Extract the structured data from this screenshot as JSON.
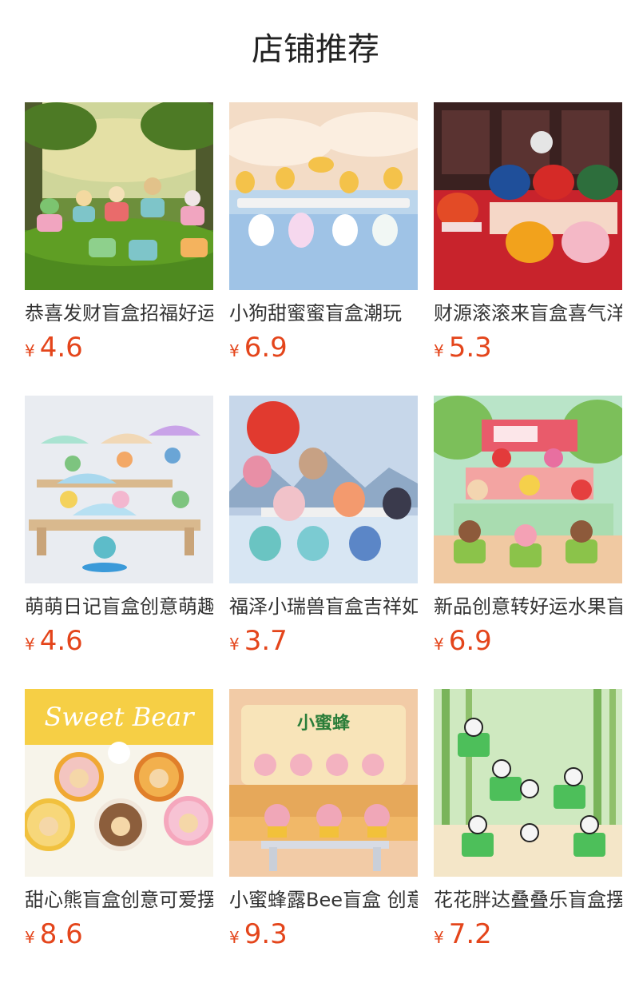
{
  "page": {
    "title": "店铺推荐"
  },
  "products": [
    {
      "name": "恭喜发财盲盒招福好运",
      "currency": "¥",
      "price": "4.6",
      "image": "garden-figurine-set"
    },
    {
      "name": "小狗甜蜜蜜盲盒潮玩",
      "currency": "¥",
      "price": "6.9",
      "image": "puppy-figurine-set"
    },
    {
      "name": "财源滚滚来盲盒喜气洋洋",
      "currency": "¥",
      "price": "5.3",
      "image": "fortune-god-figurine-set"
    },
    {
      "name": "萌萌日记盲盒创意萌趣",
      "currency": "¥",
      "price": "4.6",
      "image": "umbrella-figurine-set"
    },
    {
      "name": "福泽小瑞兽盲盒吉祥如意",
      "currency": "¥",
      "price": "3.7",
      "image": "lion-dance-figurine-set"
    },
    {
      "name": "新品创意转好运水果盲盒",
      "currency": "¥",
      "price": "6.9",
      "image": "fruit-can-figurine-set"
    },
    {
      "name": "甜心熊盲盒创意可爱摆件",
      "currency": "¥",
      "price": "8.6",
      "image": "sweet-bear-figurine-set",
      "image_text": "Sweet Bear"
    },
    {
      "name": "小蜜蜂露Bee盲盒 创意",
      "currency": "¥",
      "price": "9.3",
      "image": "bee-figurine-set",
      "image_text": "小蜜蜂"
    },
    {
      "name": "花花胖达叠叠乐盲盒摆件",
      "currency": "¥",
      "price": "7.2",
      "image": "panda-bamboo-figurine-set"
    }
  ]
}
